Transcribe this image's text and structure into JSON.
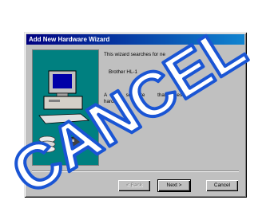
{
  "dialog": {
    "title": "Add New Hardware Wizard",
    "intro_text": "This wizard searches for ne",
    "intro_text_end": "for",
    "device_name": "Brother HL-1",
    "body_line1_start": "A",
    "body_line1_mid": "software",
    "body_line1_end": "that makes a",
    "body_line2": "hardw"
  },
  "buttons": {
    "back_label": "< Back",
    "next_label": "Next >",
    "cancel_label": "Cancel"
  },
  "watermark": {
    "text": "CANCEL",
    "color": "#1a55d4"
  },
  "colors": {
    "title_bar": "#000080",
    "dialog_face": "#c0c0c0",
    "illustration_bg": "#008080"
  }
}
